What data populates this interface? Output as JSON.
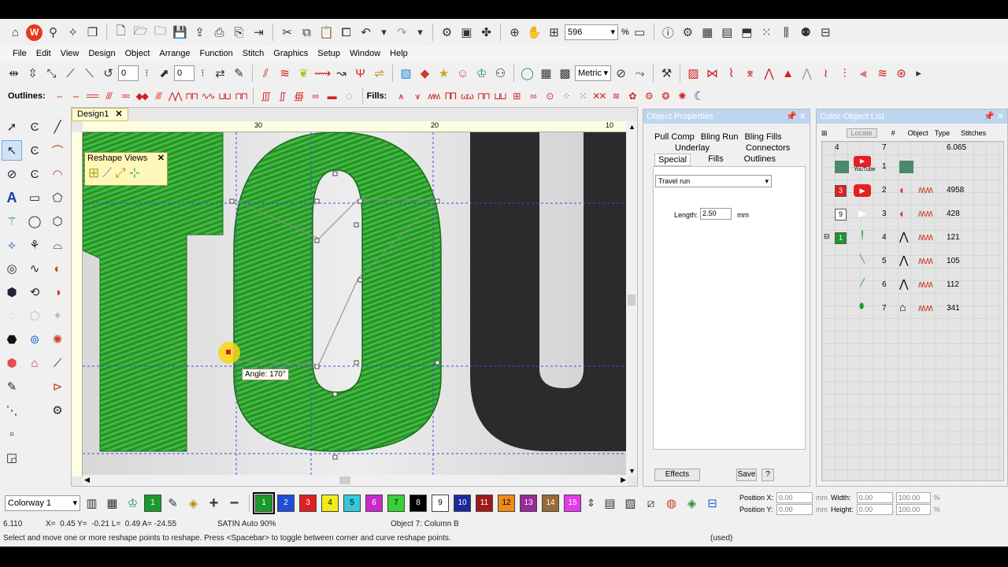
{
  "toolbar": {
    "zoom_value": "596",
    "zoom_unit": "%"
  },
  "menu": [
    "File",
    "Edit",
    "View",
    "Design",
    "Object",
    "Arrange",
    "Function",
    "Stitch",
    "Graphics",
    "Setup",
    "Window",
    "Help"
  ],
  "toolbar2": {
    "angle_value": "0",
    "width_value": "0",
    "units": "Metric"
  },
  "toolbar3": {
    "outlines_label": "Outlines:",
    "fills_label": "Fills:"
  },
  "document": {
    "tab_title": "Design1",
    "ruler_marks": [
      "30",
      "20",
      "10"
    ]
  },
  "reshape_views": {
    "title": "Reshape Views"
  },
  "canvas": {
    "angle_tooltip": "Angle: 170°"
  },
  "object_properties": {
    "title": "Object Properties",
    "tabs_row1": [
      "Pull Comp",
      "Bling Run",
      "Bling Fills"
    ],
    "tabs_row2": [
      "Underlay",
      "Connectors"
    ],
    "tabs_row3": [
      "Special",
      "Fills",
      "Outlines"
    ],
    "travel_select": "Travel run",
    "length_label": "Length:",
    "length_value": "2.50",
    "length_unit": "mm",
    "effects_button": "Effects",
    "save_button": "Save",
    "help_button": "?"
  },
  "color_object_list": {
    "title": "Color-Object List",
    "locate_button": "Locate",
    "headers": [
      "#",
      "Object",
      "Type",
      "Stitches"
    ],
    "summary": {
      "colors": "4",
      "objects": "7",
      "stitches": "6.065"
    },
    "youtube_label": "YouTube",
    "rows": [
      {
        "num": "1",
        "stitches": ""
      },
      {
        "num": "2",
        "swatch": "3",
        "stitches": "4958"
      },
      {
        "num": "3",
        "swatch": "9",
        "stitches": "428"
      },
      {
        "num": "4",
        "swatch": "1",
        "stitches": "121"
      },
      {
        "num": "5",
        "stitches": "105"
      },
      {
        "num": "6",
        "stitches": "112"
      },
      {
        "num": "7",
        "stitches": "341"
      }
    ]
  },
  "colorbar": {
    "colorway": "Colorway 1",
    "selected": "1",
    "palette": [
      {
        "n": "1",
        "c": "#1a9a2a"
      },
      {
        "n": "2",
        "c": "#1f4fd8"
      },
      {
        "n": "3",
        "c": "#e02020"
      },
      {
        "n": "4",
        "c": "#f2ea1a"
      },
      {
        "n": "5",
        "c": "#35c8d8"
      },
      {
        "n": "6",
        "c": "#c82ac8"
      },
      {
        "n": "7",
        "c": "#38d038"
      },
      {
        "n": "8",
        "c": "#000000"
      },
      {
        "n": "9",
        "c": "#ffffff"
      },
      {
        "n": "10",
        "c": "#1a2a9a"
      },
      {
        "n": "11",
        "c": "#a01818"
      },
      {
        "n": "12",
        "c": "#f08a1a"
      },
      {
        "n": "13",
        "c": "#9a2a9a"
      },
      {
        "n": "14",
        "c": "#9a6a3a"
      },
      {
        "n": "15",
        "c": "#e838e8"
      }
    ],
    "position_x_label": "Position X:",
    "position_y_label": "Position Y:",
    "width_label": "Width:",
    "height_label": "Height:",
    "pos_x": "0.00",
    "pos_y": "0.00",
    "width": "0.00",
    "height": "0.00",
    "unit_mm": "mm",
    "scale_w": "100.00",
    "scale_h": "100.00",
    "unit_pct": "%"
  },
  "status": {
    "stitch_count": "6.110",
    "coords": "X=  0.45 Y=  -0.21 L=  0.49 A= -24.55",
    "stitch_type": "SATIN Auto 90%",
    "object_info": "Object 7: Column B",
    "prompt": "Select and move one or more reshape points to reshape. Press <Spacebar> to toggle between corner and curve reshape points.",
    "used": "(used)"
  },
  "colors": {
    "green_fill": "#2fa52f",
    "dark_letter": "#2b2b2b",
    "panel_header": "#bdd5ee"
  }
}
